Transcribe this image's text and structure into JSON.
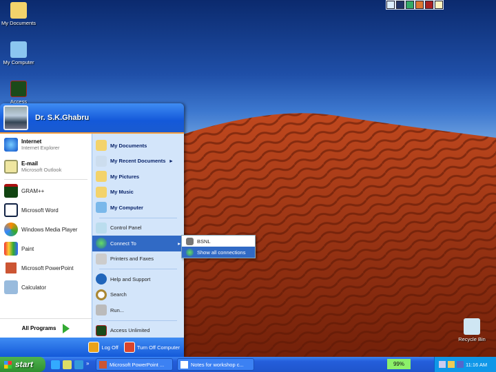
{
  "desktop": {
    "icons": [
      {
        "label": "My Documents",
        "icon": "folder-documents-icon"
      },
      {
        "label": "My Computer",
        "icon": "computer-icon"
      },
      {
        "label": "Access",
        "icon": "access-icon"
      },
      {
        "label": "Recycle Bin",
        "icon": "recycle-bin-icon"
      }
    ]
  },
  "start_menu": {
    "user": "Dr. S.K.Ghabru",
    "pinned": [
      {
        "title": "Internet",
        "subtitle": "Internet Explorer"
      },
      {
        "title": "E-mail",
        "subtitle": "Microsoft Outlook"
      }
    ],
    "recent": [
      "GRAM++",
      "Microsoft Word",
      "Windows Media Player",
      "Paint",
      "Microsoft PowerPoint",
      "Calculator"
    ],
    "all_programs": "All Programs",
    "places": [
      "My Documents",
      "My Recent Documents",
      "My Pictures",
      "My Music",
      "My Computer"
    ],
    "system": [
      "Control Panel",
      "Connect To",
      "Printers and Faxes"
    ],
    "help": [
      "Help and Support",
      "Search",
      "Run..."
    ],
    "extra": [
      "Access Unlimited"
    ],
    "log_off": "Log Off",
    "turn_off": "Turn Off Computer",
    "submenu": [
      "BSNL",
      "Show all connections"
    ]
  },
  "taskbar": {
    "start": "start",
    "windows": [
      "Microsoft PowerPoint ...",
      "Notes for workshop c..."
    ],
    "battery": "99%",
    "clock": "11:16 AM"
  },
  "colors": {
    "accent": "#316ac5",
    "taskbar": "#245edb",
    "start": "#2f8f2f",
    "battery": "#8cf06a"
  }
}
